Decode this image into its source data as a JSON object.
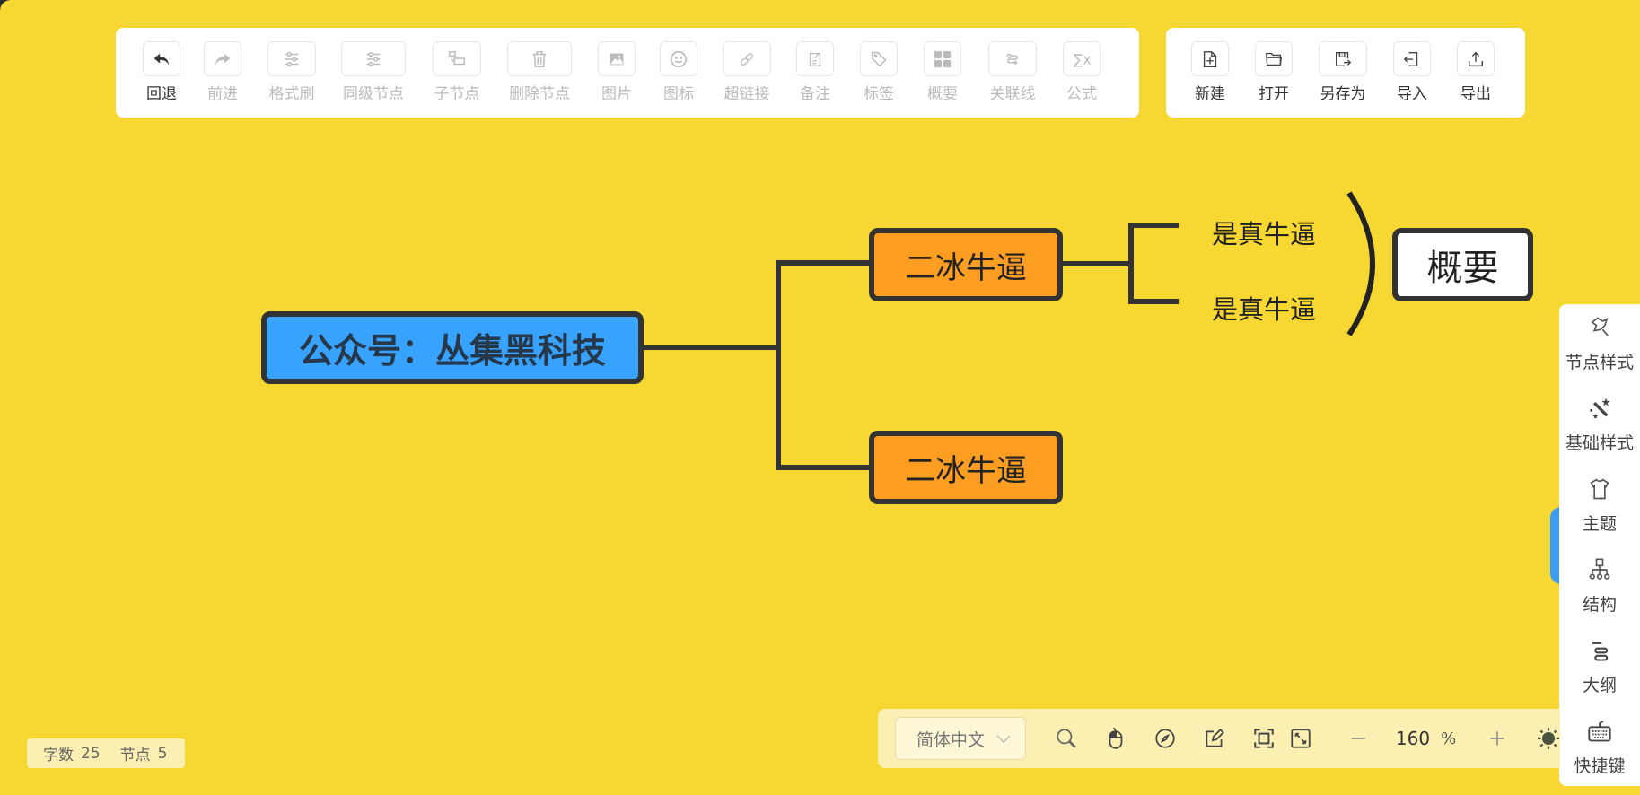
{
  "toolbar_main": [
    {
      "id": "undo",
      "label": "回退",
      "icon": "undo-icon",
      "enabled": true
    },
    {
      "id": "redo",
      "label": "前进",
      "icon": "redo-icon",
      "enabled": false
    },
    {
      "id": "format-painter",
      "label": "格式刷",
      "icon": "sliders-icon",
      "enabled": false
    },
    {
      "id": "sibling-node",
      "label": "同级节点",
      "icon": "sliders-icon",
      "enabled": false
    },
    {
      "id": "child-node",
      "label": "子节点",
      "icon": "child-node-icon",
      "enabled": false
    },
    {
      "id": "delete-node",
      "label": "删除节点",
      "icon": "trash-icon",
      "enabled": false
    },
    {
      "id": "image",
      "label": "图片",
      "icon": "image-icon",
      "enabled": false
    },
    {
      "id": "icon",
      "label": "图标",
      "icon": "smiley-icon",
      "enabled": false
    },
    {
      "id": "hyperlink",
      "label": "超链接",
      "icon": "link-icon",
      "enabled": false
    },
    {
      "id": "note",
      "label": "备注",
      "icon": "note-icon",
      "enabled": false
    },
    {
      "id": "tag",
      "label": "标签",
      "icon": "tag-icon",
      "enabled": false
    },
    {
      "id": "summary",
      "label": "概要",
      "icon": "grid-icon",
      "enabled": false
    },
    {
      "id": "relation-line",
      "label": "关联线",
      "icon": "relation-line-icon",
      "enabled": false
    },
    {
      "id": "formula",
      "label": "公式",
      "icon": "sigma-icon",
      "enabled": false
    }
  ],
  "toolbar_file": [
    {
      "id": "new",
      "label": "新建",
      "icon": "new-file-icon",
      "enabled": true
    },
    {
      "id": "open",
      "label": "打开",
      "icon": "folder-icon",
      "enabled": true
    },
    {
      "id": "save-as",
      "label": "另存为",
      "icon": "save-as-icon",
      "enabled": true
    },
    {
      "id": "import",
      "label": "导入",
      "icon": "import-icon",
      "enabled": true
    },
    {
      "id": "export",
      "label": "导出",
      "icon": "export-icon",
      "enabled": true
    }
  ],
  "mindmap": {
    "root": "公众号：丛集黑科技",
    "branches": [
      "二冰牛逼",
      "二冰牛逼"
    ],
    "leaves": [
      "是真牛逼",
      "是真牛逼"
    ],
    "summary": "概要"
  },
  "right_sidebar": [
    {
      "id": "node-style",
      "label": "节点样式",
      "icon": "node-style-icon"
    },
    {
      "id": "base-style",
      "label": "基础样式",
      "icon": "magic-wand-icon"
    },
    {
      "id": "theme",
      "label": "主题",
      "icon": "shirt-icon"
    },
    {
      "id": "structure",
      "label": "结构",
      "icon": "structure-icon"
    },
    {
      "id": "outline",
      "label": "大纲",
      "icon": "outline-icon"
    },
    {
      "id": "shortcuts",
      "label": "快捷键",
      "icon": "keyboard-icon"
    }
  ],
  "bottom_bar": {
    "language": "简体中文",
    "zoom": "160",
    "zoom_unit": "%"
  },
  "stats": {
    "word_count_label": "字数",
    "word_count": "25",
    "node_count_label": "节点",
    "node_count": "5"
  },
  "colors": {
    "background": "#f7d731",
    "root_fill": "#38a3ff",
    "branch_fill": "#fd9e22",
    "line": "#333333",
    "accent": "#3d9df5"
  }
}
